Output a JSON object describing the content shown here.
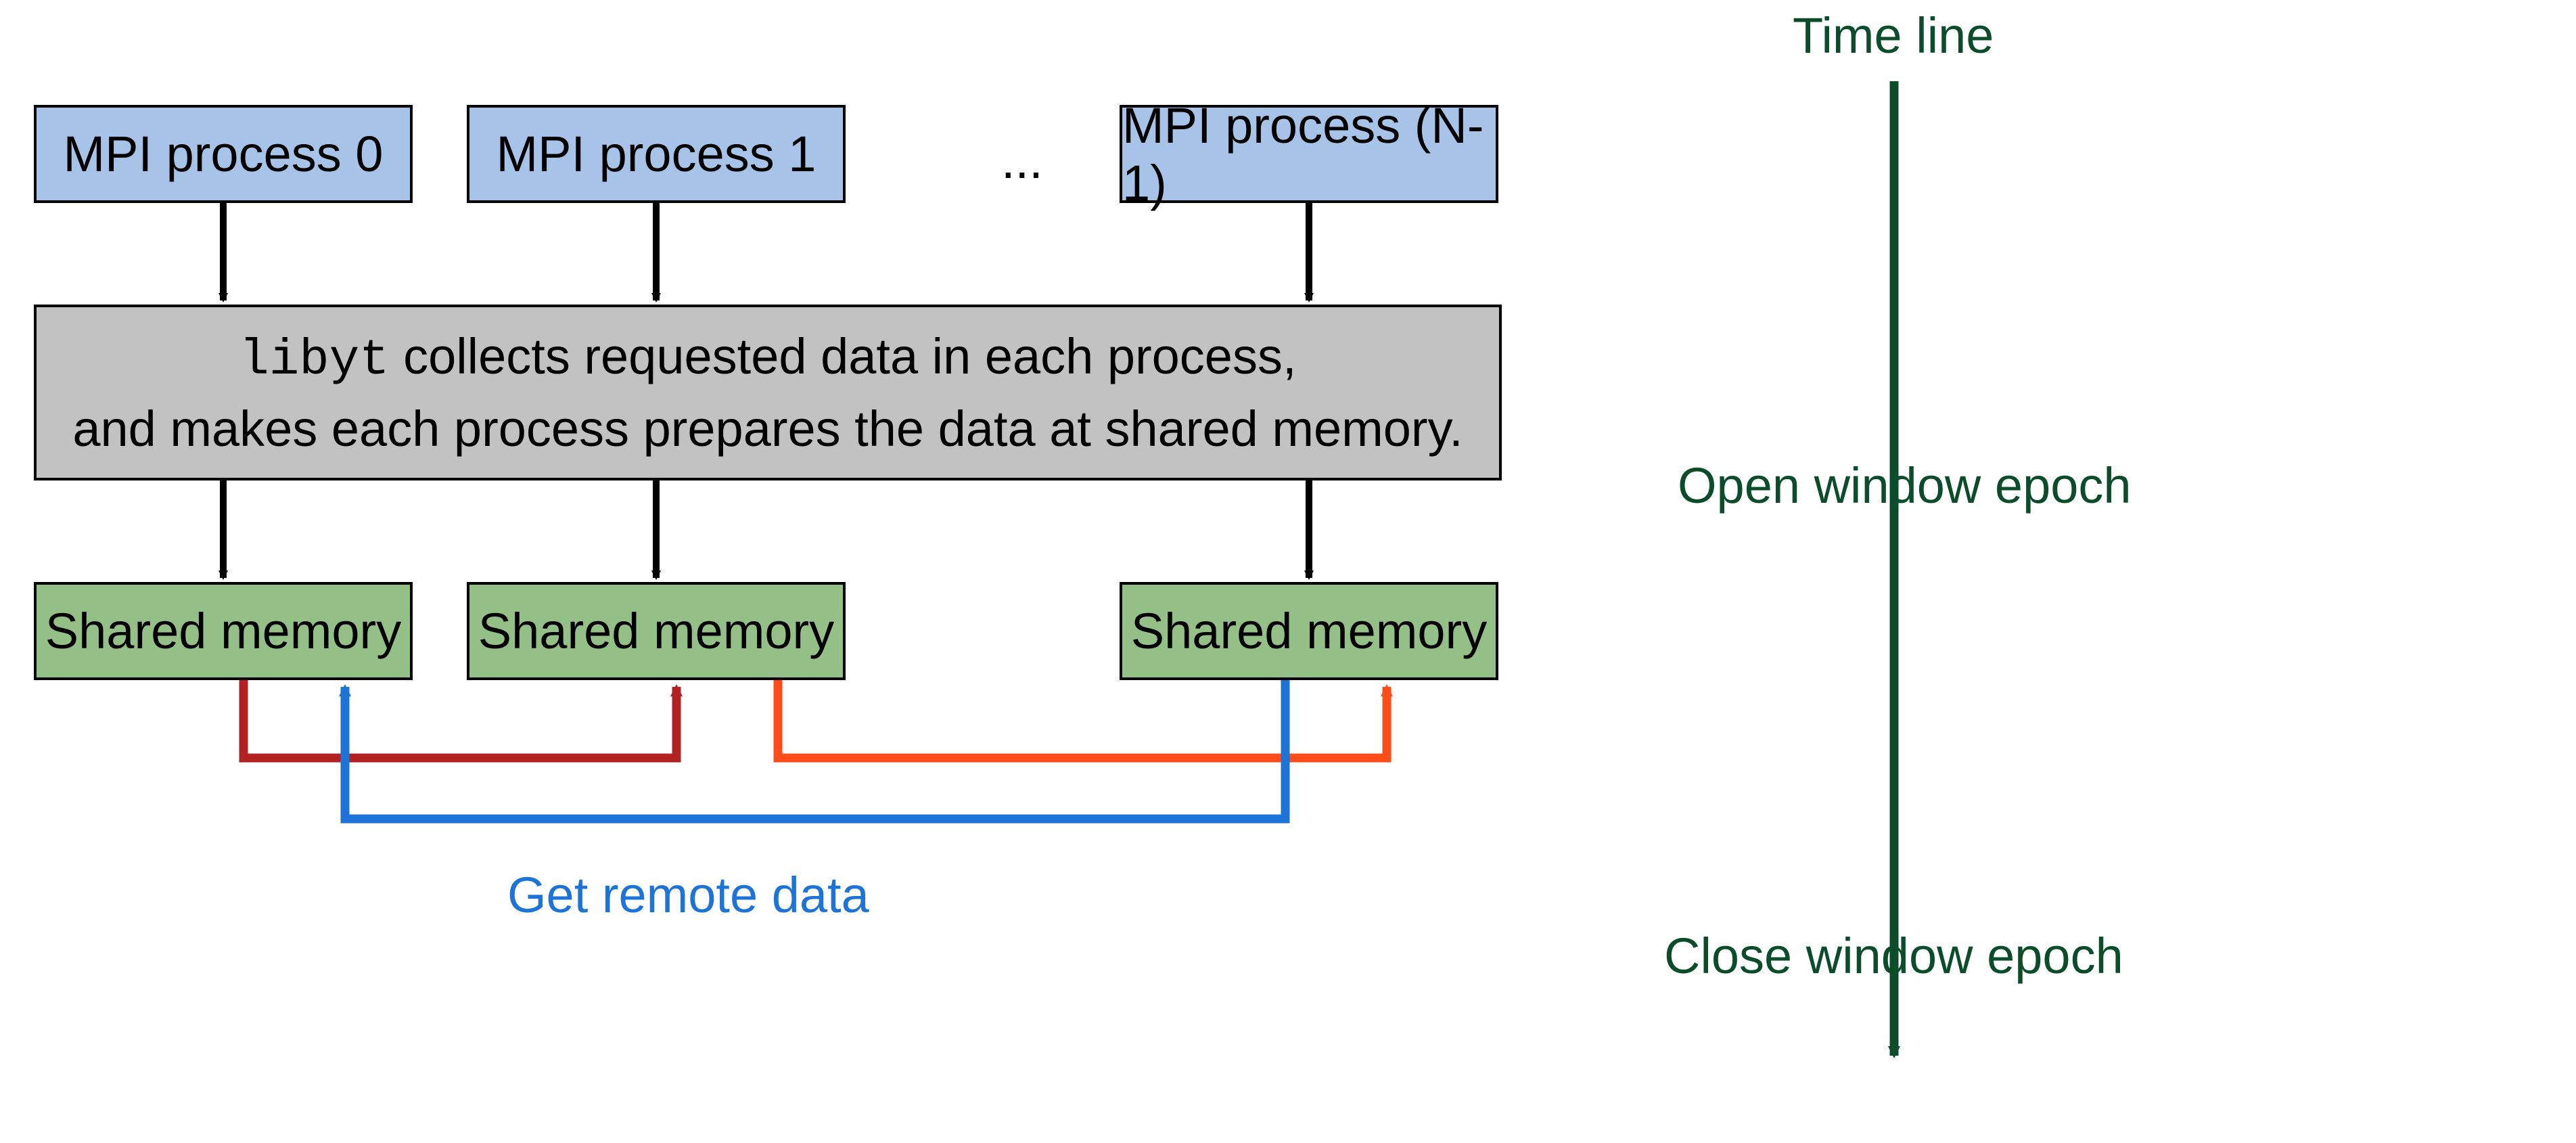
{
  "mpi": {
    "p0": "MPI process 0",
    "p1": "MPI process 1",
    "pN": "MPI process (N-1)",
    "ellipsis": "..."
  },
  "collect": {
    "code": "libyt",
    "line1_rest": " collects requested data in each process,",
    "line2": "and makes each process prepares the data at shared memory."
  },
  "shared": {
    "label": "Shared memory"
  },
  "labels": {
    "get_remote": "Get remote data",
    "timeline": "Time line",
    "open": "Open window epoch",
    "close": "Close window epoch"
  }
}
